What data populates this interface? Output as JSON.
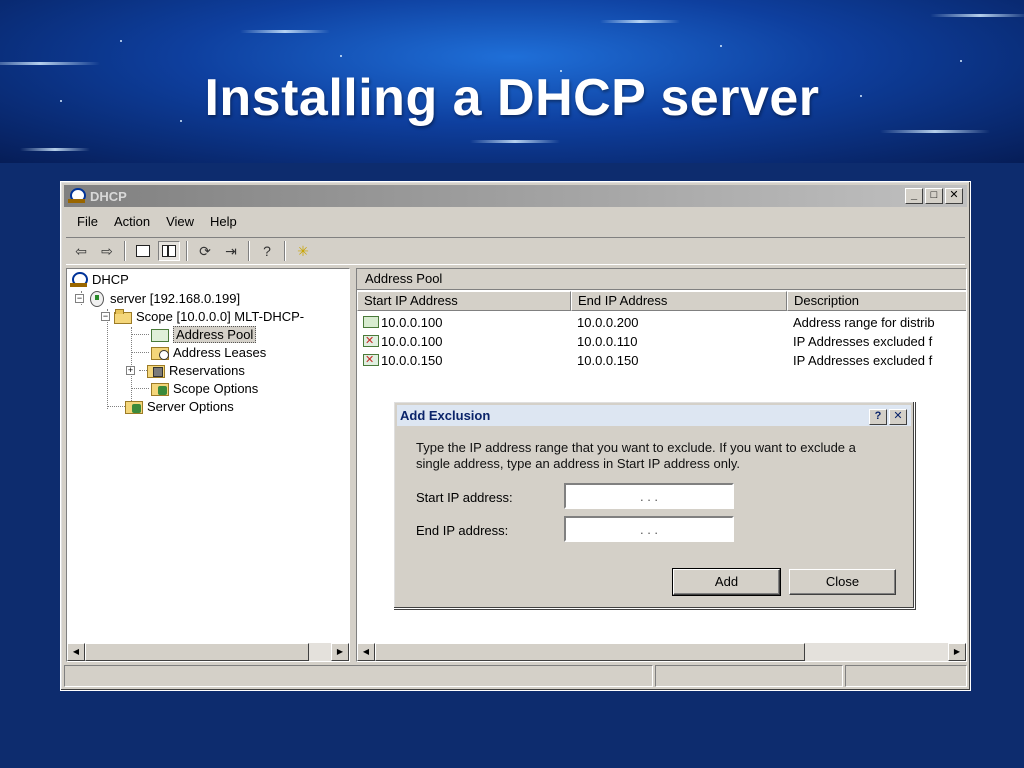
{
  "slide": {
    "title": "Installing a DHCP server"
  },
  "window": {
    "title": "DHCP",
    "controls": {
      "minimize": "_",
      "maximize": "□",
      "close": "✕"
    }
  },
  "menu": [
    "File",
    "Action",
    "View",
    "Help"
  ],
  "toolbar": [
    "back-icon",
    "forward-icon",
    "up-folder-icon",
    "show-hide-tree-icon",
    "refresh-icon",
    "export-list-icon",
    "help-icon",
    "new-icon"
  ],
  "tree": {
    "root": "DHCP",
    "server": "server [192.168.0.199]",
    "scope": "Scope [10.0.0.0] MLT-DHCP-",
    "address_pool": "Address Pool",
    "address_leases": "Address Leases",
    "reservations": "Reservations",
    "scope_options": "Scope Options",
    "server_options": "Server Options"
  },
  "list": {
    "caption": "Address Pool",
    "columns": [
      "Start IP Address",
      "End IP Address",
      "Description"
    ],
    "rows": [
      {
        "icon": "address-range-icon",
        "start": "10.0.0.100",
        "end": "10.0.0.200",
        "desc": "Address range for distrib"
      },
      {
        "icon": "excluded-range-icon",
        "start": "10.0.0.100",
        "end": "10.0.0.110",
        "desc": "IP Addresses excluded f"
      },
      {
        "icon": "excluded-range-icon",
        "start": "10.0.0.150",
        "end": "10.0.0.150",
        "desc": "IP Addresses excluded f"
      }
    ]
  },
  "dialog": {
    "title": "Add Exclusion",
    "help_button": "?",
    "close_button": "✕",
    "description": "Type the IP address range that you want to exclude. If you want to exclude a single address, type an address in Start IP address only.",
    "start_label": "Start IP address:",
    "end_label": "End IP address:",
    "start_value": ".      .      .",
    "end_value": ".      .      .",
    "add_label": "Add",
    "close_label": "Close"
  }
}
